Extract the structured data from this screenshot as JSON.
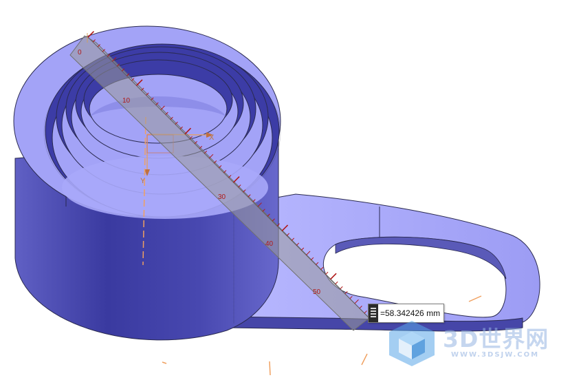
{
  "viewport": {
    "model_color": "#a3a3f7",
    "model_dark_color": "#5656b8",
    "model_edge_color": "#2a2a50",
    "ruler_color": "#8a8a8a",
    "ruler_tick_color": "#b01818",
    "axis_color": "#e0a070"
  },
  "ruler": {
    "tick_labels": [
      "0",
      "10",
      "30",
      "40",
      "50"
    ]
  },
  "triad": {
    "x_label": "X",
    "y_label": "Y"
  },
  "measurement": {
    "value": "=58.342426 mm",
    "grip_icon": "drag-handle-icon"
  },
  "watermark": {
    "text": "3D世界网",
    "url": "WWW.3DSJW.COM",
    "logo_icon": "cube-logo-icon"
  }
}
